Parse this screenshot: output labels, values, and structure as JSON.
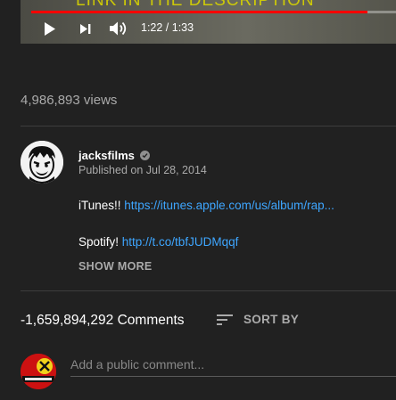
{
  "player": {
    "caption": "LINK IN THE DESCRIPTION",
    "progress_fraction": 0.921,
    "time_display": "1:22 / 1:33",
    "icons": [
      "play-icon",
      "next-icon",
      "volume-icon"
    ]
  },
  "video": {
    "title": "",
    "views": "4,986,893 views"
  },
  "channel": {
    "name": "jacksfilms",
    "published": "Published on Jul 28, 2014",
    "verified_icon": "check-circle-icon"
  },
  "description": {
    "line1_prefix": "iTunes!! ",
    "line1_link": "https://itunes.apple.com/us/album/rap...",
    "line2_prefix": "Spotify! ",
    "line2_link": "http://t.co/tbfJUDMqqf",
    "show_more": "SHOW MORE"
  },
  "comments": {
    "count": "-1,659,894,292 Comments",
    "sort_label": "SORT BY",
    "sort_icon": "sort-icon",
    "input_placeholder": "Add a public comment..."
  },
  "colors": {
    "background": "#212121",
    "link": "#3ea6ff",
    "progress": "#ff0000",
    "muted_text": "#aaaaaa"
  }
}
